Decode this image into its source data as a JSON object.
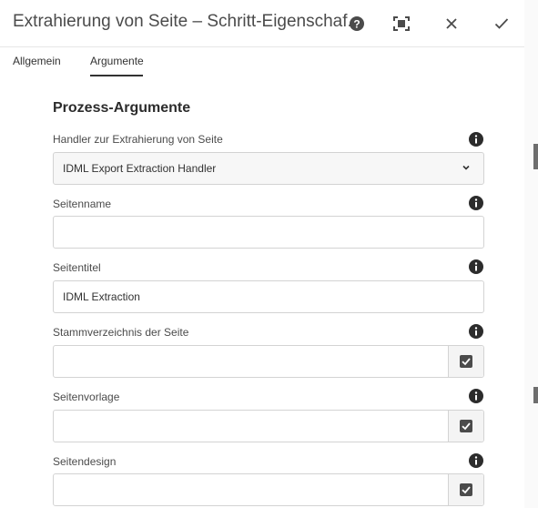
{
  "header": {
    "title": "Extrahierung von Seite – Schritt-Eigenschaf...",
    "icons": [
      "help-icon",
      "fullscreen-icon",
      "close-icon",
      "done-icon"
    ]
  },
  "tabs": [
    {
      "label": "Allgemein",
      "active": false
    },
    {
      "label": "Argumente",
      "active": true
    }
  ],
  "section": {
    "title": "Prozess-Argumente"
  },
  "fields": {
    "handler": {
      "label": "Handler zur Extrahierung von Seite",
      "value": "IDML Export Extraction Handler"
    },
    "seitenname": {
      "label": "Seitenname",
      "value": ""
    },
    "seitentitel": {
      "label": "Seitentitel",
      "value": "IDML Extraction"
    },
    "stamm": {
      "label": "Stammverzeichnis der Seite",
      "value": ""
    },
    "vorlage": {
      "label": "Seitenvorlage",
      "value": ""
    },
    "design": {
      "label": "Seitendesign",
      "value": ""
    }
  },
  "colors": {
    "text": "#323232",
    "border": "#d3d3d3",
    "icon": "#2c2c2c"
  }
}
